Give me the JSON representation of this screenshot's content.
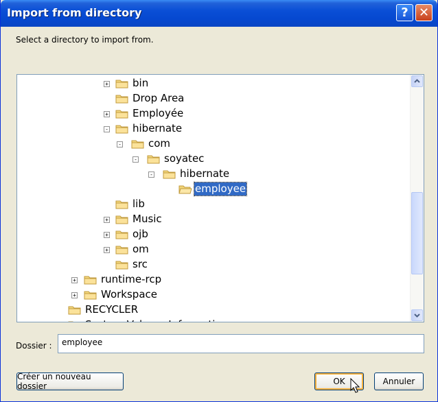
{
  "window": {
    "title": "Import from directory"
  },
  "prompt": "Select a directory to import from.",
  "tree": {
    "nodes": [
      {
        "label": "bin",
        "expander": "+"
      },
      {
        "label": "Drop Area",
        "expander": ""
      },
      {
        "label": "Employée",
        "expander": "+"
      },
      {
        "label": "hibernate",
        "expander": "−"
      },
      {
        "label": "com",
        "expander": "−"
      },
      {
        "label": "soyatec",
        "expander": "−"
      },
      {
        "label": "hibernate",
        "expander": "−"
      },
      {
        "label": "employee",
        "expander": "",
        "selected": true
      },
      {
        "label": "lib",
        "expander": ""
      },
      {
        "label": "Music",
        "expander": "+"
      },
      {
        "label": "ojb",
        "expander": "+"
      },
      {
        "label": "om",
        "expander": "+"
      },
      {
        "label": "src",
        "expander": ""
      },
      {
        "label": "runtime-rcp",
        "expander": "+"
      },
      {
        "label": "Workspace",
        "expander": "+"
      },
      {
        "label": "RECYCLER",
        "expander": ""
      },
      {
        "label": "System Volume Information",
        "expander": ""
      }
    ]
  },
  "folder_field": {
    "label": "Dossier :",
    "value": "employee"
  },
  "buttons": {
    "new_folder": "Créer un nouveau dossier",
    "ok": "OK",
    "cancel": "Annuler"
  },
  "colors": {
    "title_bar": "#0a4fd6",
    "selection": "#316ac5",
    "dialog_bg": "#ece9d8"
  }
}
